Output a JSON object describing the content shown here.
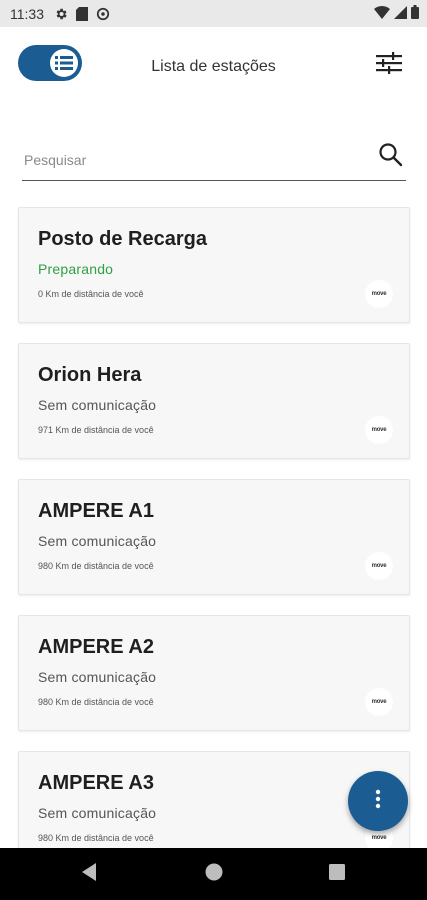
{
  "status_bar": {
    "time": "11:33",
    "left_icons": [
      "settings-icon",
      "sim-card-icon",
      "data-saver-icon"
    ],
    "right_icons": [
      "wifi-icon",
      "signal-icon",
      "battery-icon"
    ]
  },
  "app_bar": {
    "title": "Lista de estações",
    "toggle_state": "on",
    "filter_icon": "tune-icon"
  },
  "search": {
    "placeholder": "Pesquisar",
    "value": ""
  },
  "stations": [
    {
      "name": "Posto de Recarga",
      "status": "Preparando",
      "status_color": "#2ea043",
      "distance": "0 Km de distância de você",
      "logo": "move"
    },
    {
      "name": "Orion Hera",
      "status": "Sem comunicação",
      "status_color": "#555555",
      "distance": "971 Km de distância de você",
      "logo": "move"
    },
    {
      "name": "AMPERE A1",
      "status": "Sem comunicação",
      "status_color": "#555555",
      "distance": "980 Km de distância de você",
      "logo": "move"
    },
    {
      "name": "AMPERE A2",
      "status": "Sem comunicação",
      "status_color": "#555555",
      "distance": "980 Km de distância de você",
      "logo": "move"
    },
    {
      "name": "AMPERE A3",
      "status": "Sem comunicação",
      "status_color": "#555555",
      "distance": "980 Km de distância de você",
      "logo": "move"
    }
  ],
  "fab": {
    "icon": "more-vert-icon"
  },
  "colors": {
    "primary": "#1b5c93",
    "available_green": "#2ea043"
  },
  "nav_bar": {
    "buttons": [
      "back-icon",
      "home-icon",
      "recents-icon"
    ]
  }
}
